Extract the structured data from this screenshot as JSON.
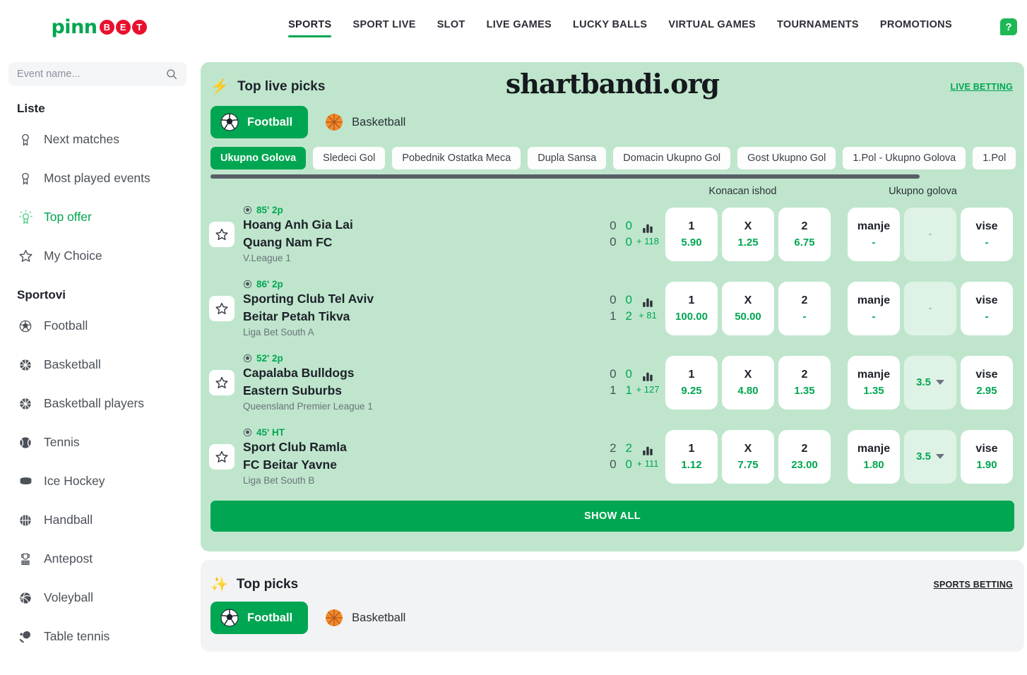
{
  "brand": {
    "part1": "pinn",
    "part2": [
      "B",
      "E",
      "T"
    ]
  },
  "nav": {
    "items": [
      {
        "label": "SPORTS",
        "active": true
      },
      {
        "label": "SPORT LIVE",
        "active": false
      },
      {
        "label": "SLOT",
        "active": false
      },
      {
        "label": "LIVE GAMES",
        "active": false
      },
      {
        "label": "LUCKY BALLS",
        "active": false
      },
      {
        "label": "VIRTUAL GAMES",
        "active": false
      },
      {
        "label": "TOURNAMENTS",
        "active": false
      },
      {
        "label": "PROMOTIONS",
        "active": false
      }
    ],
    "help_label": "?"
  },
  "sidebar": {
    "search_placeholder": "Event name...",
    "search_value": "",
    "liste_title": "Liste",
    "liste_items": [
      {
        "label": "Next matches",
        "icon": "ribbon-icon",
        "active": false
      },
      {
        "label": "Most played events",
        "icon": "ribbon-icon",
        "active": false
      },
      {
        "label": "Top offer",
        "icon": "highlight-ribbon-icon",
        "active": true
      },
      {
        "label": "My Choice",
        "icon": "star-icon",
        "active": false
      }
    ],
    "sportovi_title": "Sportovi",
    "sportovi_items": [
      {
        "label": "Football",
        "icon": "soccer-ball-icon"
      },
      {
        "label": "Basketball",
        "icon": "basketball-icon"
      },
      {
        "label": "Basketball players",
        "icon": "basketball-icon"
      },
      {
        "label": "Tennis",
        "icon": "tennis-ball-icon"
      },
      {
        "label": "Ice Hockey",
        "icon": "hockey-puck-icon"
      },
      {
        "label": "Handball",
        "icon": "handball-icon"
      },
      {
        "label": "Antepost",
        "icon": "trophy-gate-icon"
      },
      {
        "label": "Voleyball",
        "icon": "volleyball-icon"
      },
      {
        "label": "Table tennis",
        "icon": "table-tennis-paddle-icon"
      }
    ]
  },
  "live_section": {
    "title": "Top live picks",
    "watermark": "shartbandi.org",
    "link_label": "LIVE BETTING",
    "sport_tabs": [
      {
        "label": "Football",
        "icon": "soccer-ball-icon",
        "active": true
      },
      {
        "label": "Basketball",
        "icon": "basketball-icon",
        "active": false
      }
    ],
    "chips": [
      {
        "label": "Ukupno Golova",
        "active": true
      },
      {
        "label": "Sledeci Gol",
        "active": false
      },
      {
        "label": "Pobednik Ostatka Meca",
        "active": false
      },
      {
        "label": "Dupla Sansa",
        "active": false
      },
      {
        "label": "Domacin Ukupno Gol",
        "active": false
      },
      {
        "label": "Gost Ukupno Gol",
        "active": false
      },
      {
        "label": "1.Pol - Ukupno Golova",
        "active": false
      },
      {
        "label": "1.Pol",
        "active": false
      }
    ],
    "column_headers": {
      "outcome": "Konacan ishod",
      "total": "Ukupno golova"
    },
    "matches": [
      {
        "time": "85' 2p",
        "home": "Hoang Anh Gia Lai",
        "away": "Quang Nam FC",
        "league": "V.League 1",
        "score_home_ht": "0",
        "score_home_cur": "0",
        "score_away_ht": "0",
        "score_away_cur": "0",
        "more_markets": "+ 118",
        "odd_1_label": "1",
        "odd_1_value": "5.90",
        "odd_x_label": "X",
        "odd_x_value": "1.25",
        "odd_2_label": "2",
        "odd_2_value": "6.75",
        "under_label": "manje",
        "under_value": "-",
        "total_value": "-",
        "total_has_chevron": false,
        "over_label": "vise",
        "over_value": "-"
      },
      {
        "time": "86' 2p",
        "home": "Sporting Club Tel Aviv",
        "away": "Beitar Petah Tikva",
        "league": "Liga Bet South A",
        "score_home_ht": "0",
        "score_home_cur": "0",
        "score_away_ht": "1",
        "score_away_cur": "2",
        "more_markets": "+ 81",
        "odd_1_label": "1",
        "odd_1_value": "100.00",
        "odd_x_label": "X",
        "odd_x_value": "50.00",
        "odd_2_label": "2",
        "odd_2_value": "-",
        "under_label": "manje",
        "under_value": "-",
        "total_value": "-",
        "total_has_chevron": false,
        "over_label": "vise",
        "over_value": "-"
      },
      {
        "time": "52' 2p",
        "home": "Capalaba Bulldogs",
        "away": "Eastern Suburbs",
        "league": "Queensland Premier League 1",
        "score_home_ht": "0",
        "score_home_cur": "0",
        "score_away_ht": "1",
        "score_away_cur": "1",
        "more_markets": "+ 127",
        "odd_1_label": "1",
        "odd_1_value": "9.25",
        "odd_x_label": "X",
        "odd_x_value": "4.80",
        "odd_2_label": "2",
        "odd_2_value": "1.35",
        "under_label": "manje",
        "under_value": "1.35",
        "total_value": "3.5",
        "total_has_chevron": true,
        "over_label": "vise",
        "over_value": "2.95"
      },
      {
        "time": "45' HT",
        "home": "Sport Club Ramla",
        "away": "FC Beitar Yavne",
        "league": "Liga Bet South B",
        "score_home_ht": "2",
        "score_home_cur": "2",
        "score_away_ht": "0",
        "score_away_cur": "0",
        "more_markets": "+ 111",
        "odd_1_label": "1",
        "odd_1_value": "1.12",
        "odd_x_label": "X",
        "odd_x_value": "7.75",
        "odd_2_label": "2",
        "odd_2_value": "23.00",
        "under_label": "manje",
        "under_value": "1.80",
        "total_value": "3.5",
        "total_has_chevron": true,
        "over_label": "vise",
        "over_value": "1.90"
      }
    ],
    "show_all_label": "SHOW ALL"
  },
  "picks_section": {
    "title": "Top picks",
    "link_label": "SPORTS BETTING",
    "sport_tabs": [
      {
        "label": "Football",
        "icon": "soccer-ball-icon",
        "active": true
      },
      {
        "label": "Basketball",
        "icon": "basketball-icon",
        "active": false
      }
    ]
  },
  "colors": {
    "brand_green": "#00a651",
    "brand_red": "#e8112d",
    "live_card_bg": "#bfe6cd",
    "total_cell_bg": "#dff2e6",
    "picks_card_bg": "#f2f3f4"
  }
}
